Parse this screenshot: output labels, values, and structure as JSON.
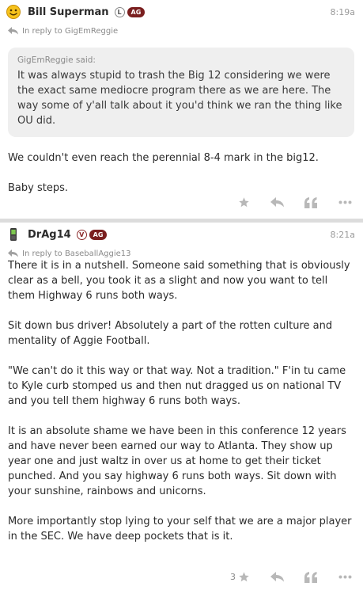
{
  "post1": {
    "username": "Bill Superman",
    "badge_l": "L",
    "badge_ag": "AG",
    "time": "8:19a",
    "reply_to": "In reply to GigEmReggie",
    "quote_author": "GigEmReggie said:",
    "quote_text": "It was always stupid to trash the Big 12 considering we were the exact same mediocre program there as we are here. The way some of y'all talk about it you'd think we ran the thing like OU did.",
    "paragraphs": [
      "We couldn't even reach the perennial 8-4 mark in the big12.",
      "Baby steps."
    ]
  },
  "post2": {
    "username": "DrAg14",
    "badge_v": "V",
    "badge_ag": "AG",
    "time": "8:21a",
    "reply_to": "In reply to BaseballAggie13",
    "paragraphs": [
      "There it is in a nutshell. Someone said something that is obviously clear as a bell, you took it as a slight and now you want to tell them Highway 6 runs both ways.",
      "Sit down bus driver! Absolutely a part of the rotten culture and mentality of Aggie Football.",
      "\"We can't do it this way or that way. Not a tradition.\" F'in tu came to Kyle curb stomped us and then nut dragged us on national TV and you tell them highway 6 runs both ways.",
      "It is an absolute shame we have been in this conference 12 years and have never been earned our way to Atlanta. They show up year one and just waltz in over us at home to get their ticket punched. And you say highway 6 runs both ways. Sit down with your sunshine, rainbows and unicorns.",
      "",
      "More importantly stop lying to your self that we are a major player in the SEC. We have deep pockets that is it."
    ],
    "star_count": "3"
  },
  "icons": [
    "smiley-avatar-icon",
    "phone-avatar-icon",
    "reply-arrow-icon",
    "star-icon",
    "reply-icon",
    "quote-icon",
    "more-icon"
  ]
}
